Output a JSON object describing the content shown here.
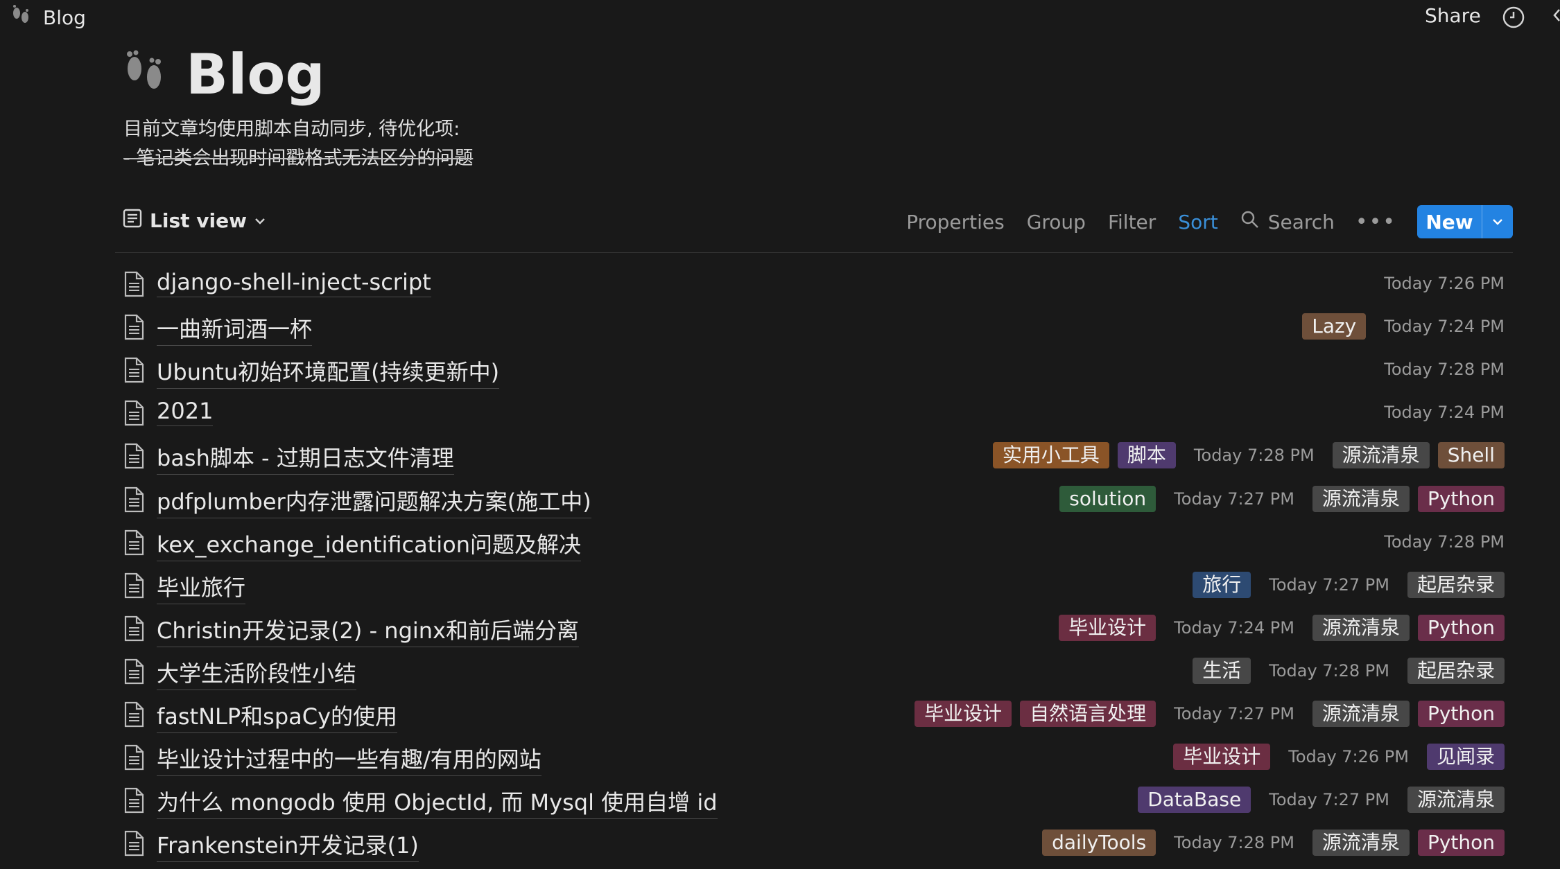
{
  "breadcrumb": {
    "label": "Blog"
  },
  "topbar": {
    "share_label": "Share"
  },
  "page": {
    "title": "Blog",
    "description_line1": "目前文章均使用脚本自动同步, 待优化项:",
    "description_line2": "- 笔记类会出现时间戳格式无法区分的问题"
  },
  "toolbar": {
    "view_label": "List view",
    "properties": "Properties",
    "group": "Group",
    "filter": "Filter",
    "sort": "Sort",
    "search": "Search",
    "new_label": "New"
  },
  "colors": {
    "accent": "#2383e2",
    "sort_active": "#3a8fd8",
    "tag_brown": "#6e4f3a",
    "tag_orange": "#8a5427",
    "tag_purple": "#4f3a6e",
    "tag_green": "#2e5b3a",
    "tag_gray": "#474747",
    "tag_red": "#6b2e42",
    "tag_blue": "#2d4a72",
    "tag_pink": "#6a2e4a"
  },
  "rows": [
    {
      "title": "django-shell-inject-script",
      "tags": [],
      "time": "Today 7:26 PM",
      "after": []
    },
    {
      "title": "一曲新词酒一杯",
      "tags": [
        {
          "label": "Lazy",
          "color": "#6e4f3a"
        }
      ],
      "time": "Today 7:24 PM",
      "after": []
    },
    {
      "title": "Ubuntu初始环境配置(持续更新中)",
      "tags": [],
      "time": "Today 7:28 PM",
      "after": []
    },
    {
      "title": "2021",
      "tags": [],
      "time": "Today 7:24 PM",
      "after": []
    },
    {
      "title": "bash脚本 - 过期日志文件清理",
      "tags": [
        {
          "label": "实用小工具",
          "color": "#8a5427"
        },
        {
          "label": "脚本",
          "color": "#4f3a6e"
        }
      ],
      "time": "Today 7:28 PM",
      "after": [
        {
          "label": "源流清泉",
          "color": "#474747"
        },
        {
          "label": "Shell",
          "color": "#6e4f3a"
        }
      ]
    },
    {
      "title": "pdfplumber内存泄露问题解决方案(施工中)",
      "tags": [
        {
          "label": "solution",
          "color": "#2e5b3a"
        }
      ],
      "time": "Today 7:27 PM",
      "after": [
        {
          "label": "源流清泉",
          "color": "#474747"
        },
        {
          "label": "Python",
          "color": "#6a2e4a"
        }
      ]
    },
    {
      "title": "kex_exchange_identification问题及解决",
      "tags": [],
      "time": "Today 7:28 PM",
      "after": []
    },
    {
      "title": "毕业旅行",
      "tags": [
        {
          "label": "旅行",
          "color": "#2d4a72"
        }
      ],
      "time": "Today 7:27 PM",
      "after": [
        {
          "label": "起居杂录",
          "color": "#474747"
        }
      ]
    },
    {
      "title": "Christin开发记录(2) - nginx和前后端分离",
      "tags": [
        {
          "label": "毕业设计",
          "color": "#6b2e42"
        }
      ],
      "time": "Today 7:24 PM",
      "after": [
        {
          "label": "源流清泉",
          "color": "#474747"
        },
        {
          "label": "Python",
          "color": "#6a2e4a"
        }
      ]
    },
    {
      "title": "大学生活阶段性小结",
      "tags": [
        {
          "label": "生活",
          "color": "#474747"
        }
      ],
      "time": "Today 7:28 PM",
      "after": [
        {
          "label": "起居杂录",
          "color": "#474747"
        }
      ]
    },
    {
      "title": "fastNLP和spaCy的使用",
      "tags": [
        {
          "label": "毕业设计",
          "color": "#6b2e42"
        },
        {
          "label": "自然语言处理",
          "color": "#6b2e42"
        }
      ],
      "time": "Today 7:27 PM",
      "after": [
        {
          "label": "源流清泉",
          "color": "#474747"
        },
        {
          "label": "Python",
          "color": "#6a2e4a"
        }
      ]
    },
    {
      "title": "毕业设计过程中的一些有趣/有用的网站",
      "tags": [
        {
          "label": "毕业设计",
          "color": "#6b2e42"
        }
      ],
      "time": "Today 7:26 PM",
      "after": [
        {
          "label": "见闻录",
          "color": "#4f3a6e"
        }
      ]
    },
    {
      "title": "为什么 mongodb 使用 ObjectId, 而 Mysql 使用自增 id",
      "tags": [
        {
          "label": "DataBase",
          "color": "#4f3a6e"
        }
      ],
      "time": "Today 7:27 PM",
      "after": [
        {
          "label": "源流清泉",
          "color": "#474747"
        }
      ]
    },
    {
      "title": "Frankenstein开发记录(1)",
      "tags": [
        {
          "label": "dailyTools",
          "color": "#6e4f3a"
        }
      ],
      "time": "Today 7:28 PM",
      "after": [
        {
          "label": "源流清泉",
          "color": "#474747"
        },
        {
          "label": "Python",
          "color": "#6a2e4a"
        }
      ]
    }
  ]
}
